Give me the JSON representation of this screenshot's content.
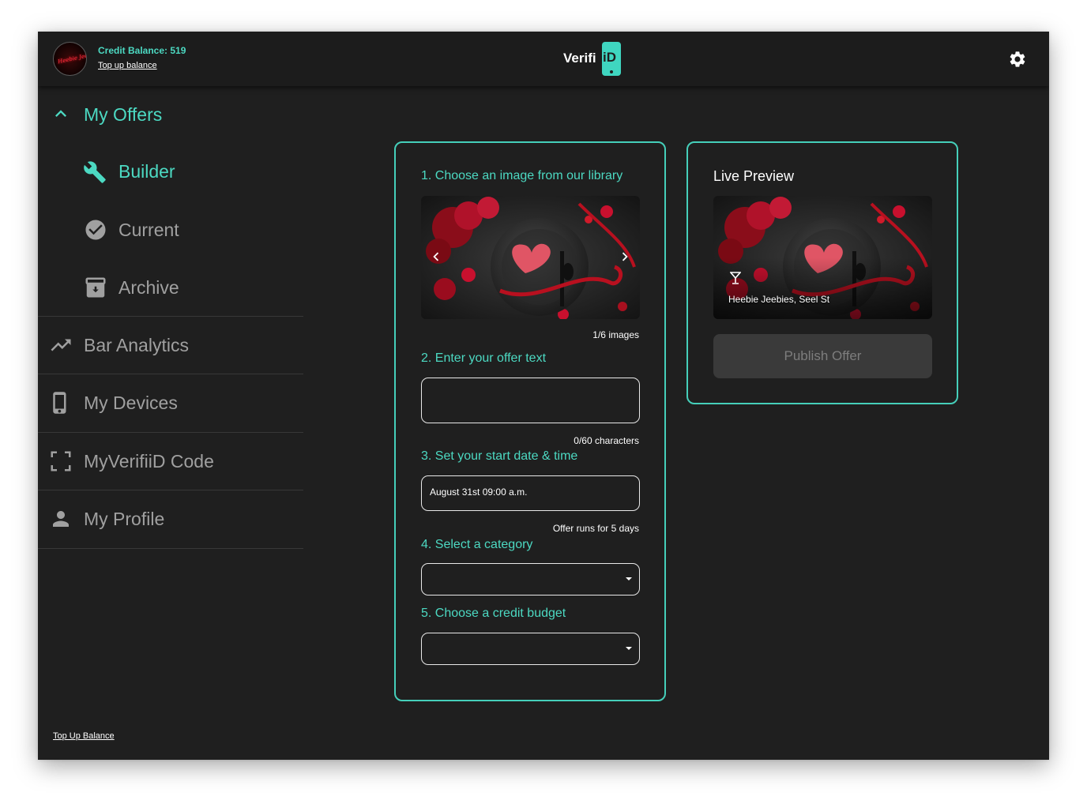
{
  "header": {
    "credit_balance": "Credit Balance: 519",
    "top_up_link": "Top up balance",
    "logo_text": "Verifi",
    "logo_badge": "iD",
    "avatar_text": "Heebie Jeebies"
  },
  "sidebar": {
    "my_offers": "My Offers",
    "builder": "Builder",
    "current": "Current",
    "archive": "Archive",
    "bar_analytics": "Bar Analytics",
    "my_devices": "My Devices",
    "code": "MyVerifiiD Code",
    "my_profile": "My Profile",
    "bottom_top_up": "Top Up Balance"
  },
  "builder": {
    "step1": "1. Choose an image from our library",
    "image_count": "1/6 images",
    "step2": "2. Enter your offer text",
    "offer_text_value": "",
    "char_count": "0/60 characters",
    "step3": "3. Set your start date & time",
    "start_date_value": "August 31st 09:00 a.m.",
    "duration_note": "Offer runs for 5 days",
    "step4": "4. Select a category",
    "category_value": "",
    "step5": "5. Choose a credit budget",
    "budget_value": ""
  },
  "preview": {
    "title": "Live Preview",
    "caption": "Heebie Jeebies, Seel St",
    "publish_label": "Publish Offer"
  },
  "colors": {
    "accent": "#4cd9c2",
    "background": "#1f1f1f",
    "inactive_text": "#a0a0a0",
    "button_disabled": "#3a3a3a"
  },
  "icons": {
    "settings": "gear-icon",
    "builder": "wrench-icon",
    "current": "check-circle-icon",
    "archive": "archive-box-icon",
    "analytics": "trending-up-icon",
    "devices": "phone-icon",
    "code": "scan-frame-icon",
    "profile": "person-icon",
    "collapse": "chevron-up-icon"
  }
}
